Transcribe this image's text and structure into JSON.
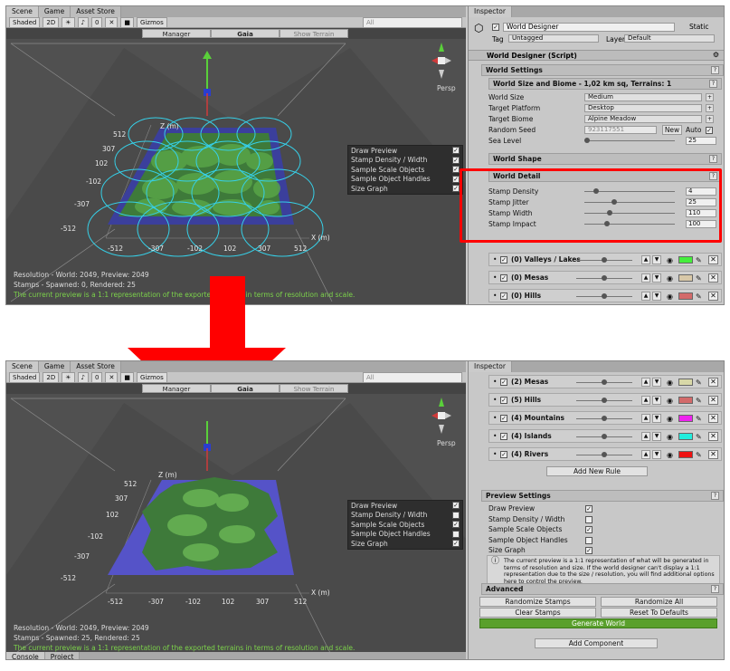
{
  "tabs": {
    "scene": "Scene",
    "game": "Game",
    "asset_store": "Asset Store",
    "inspector": "Inspector",
    "console": "Console",
    "project": "Project"
  },
  "toolbar": {
    "shading": "Shaded",
    "mode2d": "2D",
    "fx": "0",
    "gizmos": "Gizmos",
    "search": "All"
  },
  "subbar": {
    "manager": "Manager",
    "gaia": "Gaia",
    "show_terrain": "Show Terrain"
  },
  "persp": "Persp",
  "axes": {
    "x_label": "X (m)",
    "z_label": "Z (m)",
    "ticks_z": [
      "512",
      "307",
      "102",
      "-102",
      "-307",
      "-512"
    ],
    "ticks_x": [
      "-512",
      "-307",
      "-102",
      "102",
      "307",
      "512"
    ]
  },
  "overlay": {
    "items": [
      {
        "label": "Draw Preview",
        "on": true
      },
      {
        "label": "Stamp Density / Width",
        "on": true
      },
      {
        "label": "Sample Scale Objects",
        "on": true
      },
      {
        "label": "Sample Object Handles",
        "on": true
      },
      {
        "label": "Size Graph",
        "on": true
      }
    ]
  },
  "overlay2": {
    "items": [
      {
        "label": "Draw Preview",
        "on": true
      },
      {
        "label": "Stamp Density / Width",
        "on": false
      },
      {
        "label": "Sample Scale Objects",
        "on": true
      },
      {
        "label": "Sample Object Handles",
        "on": false
      },
      {
        "label": "Size Graph",
        "on": true
      }
    ]
  },
  "stats1": {
    "resolution": "Resolution - World: 2049, Preview: 2049",
    "stamps": "Stamps - Spawned: 0, Rendered: 25",
    "green": "The current preview is a 1:1 representation of the exported terrains in terms of resolution and scale."
  },
  "stats2": {
    "resolution": "Resolution - World: 2049, Preview: 2049",
    "stamps": "Stamps - Spawned: 25, Rendered: 25",
    "green": "The current preview is a 1:1 representation of the exported terrains in terms of resolution and scale."
  },
  "inspector": {
    "object_name": "World Designer",
    "static": "Static",
    "tag_label": "Tag",
    "tag": "Untagged",
    "layer_label": "Layer",
    "layer": "Default",
    "component": "World Designer (Script)",
    "world_settings": "World Settings",
    "size_biome": "World Size and Biome - 1,02 km sq, Terrains: 1",
    "fields": [
      {
        "label": "World Size",
        "value": "Medium"
      },
      {
        "label": "Target Platform",
        "value": "Desktop"
      },
      {
        "label": "Target Biome",
        "value": "Alpine Meadow"
      }
    ],
    "random_seed": {
      "label": "Random Seed",
      "value": "923117551",
      "new": "New",
      "auto": "Auto"
    },
    "sea_level": {
      "label": "Sea Level",
      "value": "25"
    },
    "world_shape": "World Shape",
    "world_detail": "World Detail",
    "detail": [
      {
        "label": "Stamp Density",
        "value": "4"
      },
      {
        "label": "Stamp Jitter",
        "value": "25"
      },
      {
        "label": "Stamp Width",
        "value": "110"
      },
      {
        "label": "Stamp Impact",
        "value": "100"
      }
    ],
    "rules_top": [
      {
        "name": "(0) Valleys / Lakes",
        "color": "#45ee3c"
      },
      {
        "name": "(0) Mesas",
        "color": "#d8c8a8"
      },
      {
        "name": "(0) Hills",
        "color": "#d36a6a"
      }
    ],
    "rules_bottom": [
      {
        "name": "(2) Mesas",
        "color": "#d8d8a8"
      },
      {
        "name": "(5) Hills",
        "color": "#d36a6a"
      },
      {
        "name": "(4) Mountains",
        "color": "#ee22ee"
      },
      {
        "name": "(4) Islands",
        "color": "#22eedd"
      },
      {
        "name": "(4) Rivers",
        "color": "#ee1111"
      }
    ],
    "add_rule": "Add New Rule",
    "preview_settings": "Preview Settings",
    "preview": [
      {
        "label": "Draw Preview",
        "on": true
      },
      {
        "label": "Stamp Density / Width",
        "on": false
      },
      {
        "label": "Sample Scale Objects",
        "on": true
      },
      {
        "label": "Sample Object Handles",
        "on": false
      },
      {
        "label": "Size Graph",
        "on": true
      }
    ],
    "note": "The current preview is a 1:1 representation of what will be generated in terms of resolution and size. If the world designer can't display a 1:1 representation due to the size / resolution, you will find additional options here to control the preview.",
    "advanced": "Advanced",
    "randomize_stamps": "Randomize Stamps",
    "randomize_all": "Randomize All",
    "clear_stamps": "Clear Stamps",
    "reset_defaults": "Reset To Defaults",
    "generate_world": "Generate World",
    "add_component": "Add Component"
  },
  "colors": {
    "highlight": "#ff0000",
    "generate": "#5aa02c"
  }
}
